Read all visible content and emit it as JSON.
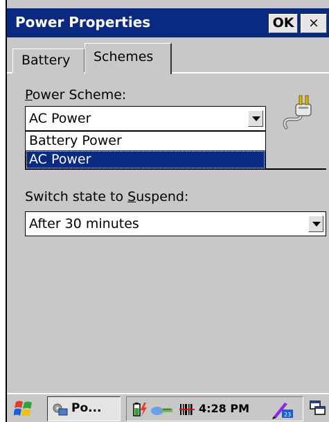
{
  "window": {
    "title": "Power Properties",
    "ok_label": "OK",
    "close_label": "×"
  },
  "tabs": [
    {
      "label": "Battery",
      "active": false
    },
    {
      "label": "Schemes",
      "active": true
    }
  ],
  "power_scheme": {
    "label_prefix": "",
    "label_accel": "P",
    "label_rest": "ower Scheme:",
    "selected": "AC Power",
    "options": [
      "Battery Power",
      "AC Power"
    ],
    "highlighted_option": "AC Power"
  },
  "suspend": {
    "label_prefix": "Switch state to ",
    "label_accel": "S",
    "label_rest": "uspend:",
    "selected": "After 30 minutes"
  },
  "taskbar": {
    "task_label": "Po...",
    "clock": "4:28 PM"
  },
  "icons": {
    "plug": "power-plug-icon",
    "start": "windows-flag-icon",
    "battery": "battery-charging-icon",
    "network": "network-icon",
    "barcode": "barcode-scanner-icon",
    "input": "input-panel-icon",
    "desktop": "desktop-icon"
  },
  "colors": {
    "title_bar": "#0a2a82",
    "selection": "#0a2a82",
    "window_bg": "#c8c8c8"
  }
}
